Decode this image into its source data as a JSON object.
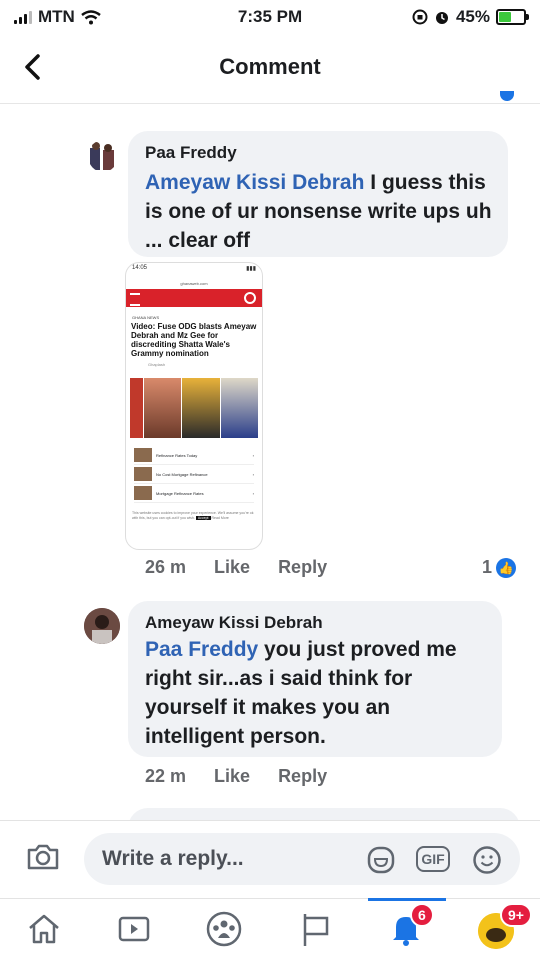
{
  "status_bar": {
    "carrier": "MTN",
    "time": "7:35 PM",
    "battery_percent": "45%",
    "battery_level": 0.45
  },
  "header": {
    "title": "Comment"
  },
  "comments": [
    {
      "author": "Paa Freddy",
      "mention": "Ameyaw Kissi Debrah",
      "text": " I guess this is one of ur nonsense write ups uh ... clear off",
      "time": "26 m",
      "like_label": "Like",
      "reply_label": "Reply",
      "reaction_count": "1",
      "attachment": {
        "time": "14:05",
        "url": "ghanaweb.com",
        "tag": "GHANA NEWS",
        "headline": "Video: Fuse ODG blasts Ameyaw Debrah and Mz Gee for discrediting Shatta Wale's Grammy nomination",
        "byline": "Ghaplash",
        "ads": [
          "Refinance Rates Today",
          "No Cost Mortgage Refinance",
          "Mortgage Refinance Rates"
        ],
        "cookie_text": "This website uses cookies to improve your experience. We'll assume you're ok with this, but you can opt-out if you wish.",
        "accept": "Accept",
        "read_more": "Read More"
      }
    },
    {
      "author": "Ameyaw Kissi Debrah",
      "mention": "Paa Freddy",
      "text": " you just proved me right sir...as i said think for yourself it makes you an intelligent person.",
      "time": "22 m",
      "like_label": "Like",
      "reply_label": "Reply"
    }
  ],
  "reply_bar": {
    "placeholder": "Write a reply...",
    "gif_label": "GIF"
  },
  "bottom_nav": {
    "notifications_badge": "6",
    "menu_badge": "9+"
  },
  "colors": {
    "accent": "#1b74e4",
    "mention": "#2f63b4",
    "badge": "#e41e3f",
    "bubble": "#f0f2f5"
  }
}
